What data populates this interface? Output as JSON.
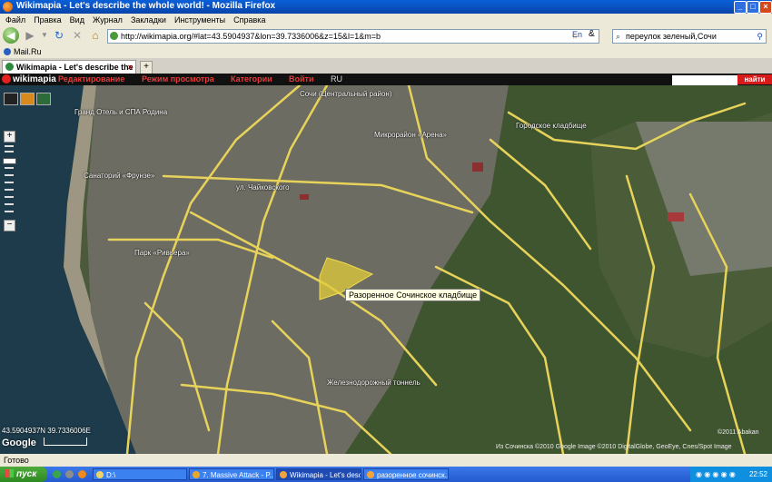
{
  "window": {
    "title": "Wikimapia - Let's describe the whole world! - Mozilla Firefox",
    "min": "_",
    "max": "□",
    "close": "×"
  },
  "menu": [
    "Файл",
    "Правка",
    "Вид",
    "Журнал",
    "Закладки",
    "Инструменты",
    "Справка"
  ],
  "nav": {
    "url": "http://wikimapia.org/#lat=43.5904937&lon=39.7336006&z=15&l=1&m=b",
    "search_value": "переулок зеленый,Сочи",
    "lang_badge": "En"
  },
  "bookmarks": {
    "item": "Mail.Ru"
  },
  "tabs": [
    {
      "label": "Wikimapia - Let's describe the whole..."
    }
  ],
  "wikimapia": {
    "logo": "wikimapia",
    "items": [
      "Редактирование",
      "Режим просмотра",
      "Категории",
      "Войти"
    ],
    "lang": "RU",
    "search_button": "найти"
  },
  "map": {
    "labels": [
      "Сочи (Центральный район)",
      "Гранд Отель и СПА Родина",
      "Микрорайон «Арена»",
      "Городское кладбище",
      "Санаторий «Фрунзе»",
      "ул. Чайковского",
      "Парк «Ривьера»",
      "Железнодорожный тоннель"
    ],
    "tooltip": "Разоренное Сочинское кладбище",
    "coords": "43.5904937N 39.7336006E",
    "google": "Google",
    "copyright": "Из Сочинска ©2010 Google Image ©2010 DigitalGlobe, GeoEye, Cnes/Spot Image",
    "copyright_right": "©2011 Abakan"
  },
  "status": {
    "text": "Готово"
  },
  "taskbar": {
    "start": "пуск",
    "tasks": [
      "D:\\",
      "7. Massive Attack - P...",
      "Wikimapia - Let's desc...",
      "разоренное сочинск..."
    ],
    "clock": "22:52"
  }
}
